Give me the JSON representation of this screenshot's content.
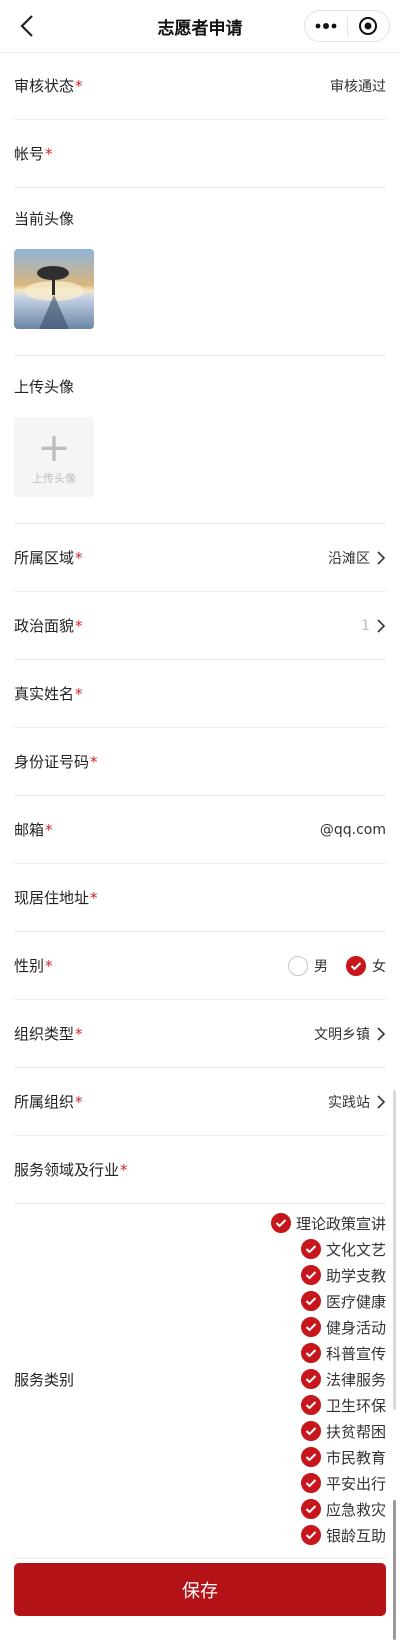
{
  "nav": {
    "title": "志愿者申请"
  },
  "fields": {
    "audit_status": {
      "label": "审核状态",
      "required": "*",
      "value": "审核通过"
    },
    "account": {
      "label": "帐号",
      "required": "*"
    },
    "current_avatar": {
      "label": "当前头像"
    },
    "upload_avatar": {
      "label": "上传头像",
      "button_text": "上传头像",
      "plus": "+"
    },
    "region": {
      "label": "所属区域",
      "required": "*",
      "value": "沿滩区"
    },
    "political": {
      "label": "政治面貌",
      "required": "*",
      "value": "1"
    },
    "real_name": {
      "label": "真实姓名",
      "required": "*"
    },
    "id_number": {
      "label": "身份证号码",
      "required": "*"
    },
    "email": {
      "label": "邮箱",
      "required": "*",
      "value": "@qq.com"
    },
    "address": {
      "label": "现居住地址",
      "required": "*"
    },
    "gender": {
      "label": "性别",
      "required": "*",
      "options": [
        "男",
        "女"
      ],
      "selected": "女"
    },
    "org_type": {
      "label": "组织类型",
      "required": "*",
      "value": "文明乡镇"
    },
    "organization": {
      "label": "所属组织",
      "required": "*",
      "value": "实践站"
    },
    "service_field": {
      "label": "服务领域及行业",
      "required": "*"
    },
    "service_category": {
      "label": "服务类别",
      "items": [
        "理论政策宣讲",
        "文化文艺",
        "助学支教",
        "医疗健康",
        "健身活动",
        "科普宣传",
        "法律服务",
        "卫生环保",
        "扶贫帮困",
        "市民教育",
        "平安出行",
        "应急救灾",
        "银龄互助"
      ]
    }
  },
  "save_button": {
    "label": "保存"
  },
  "colors": {
    "accent": "#c8161d",
    "save": "#b31217"
  }
}
